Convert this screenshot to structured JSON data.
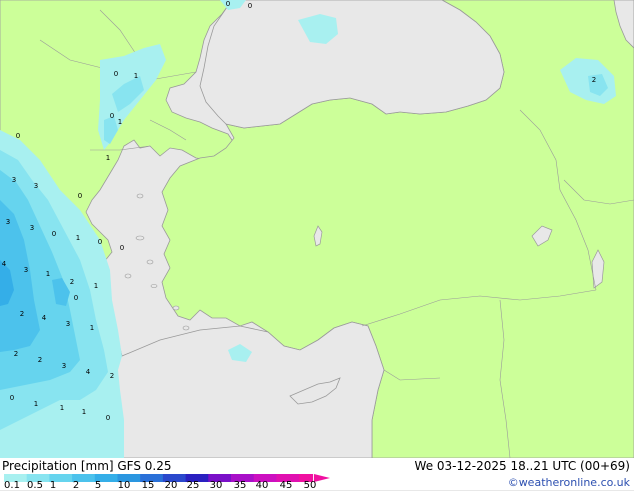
{
  "title": "Precipitation [mm]  GFS 0.25",
  "datetime": "We 03-12-2025 18..21 UTC (00+69)",
  "credit": "©weatheronline.co.uk",
  "colors": {
    "sea": "#e8e8e8",
    "land": "#ccff99",
    "coast": "#9a9a9a"
  },
  "legend": {
    "ticks": [
      "0.1",
      "0.5",
      "1",
      "2",
      "5",
      "10",
      "15",
      "20",
      "25",
      "30",
      "35",
      "40",
      "45",
      "50"
    ],
    "colors": [
      "#a8f0f0",
      "#88e4f0",
      "#66d4ee",
      "#4cc2ec",
      "#34aee8",
      "#2a96e0",
      "#2a70d8",
      "#2a48cc",
      "#2a20c0",
      "#7a10c8",
      "#a810c8",
      "#cc10c0",
      "#e010b0",
      "#f010a0"
    ]
  },
  "point_values": [
    {
      "v": "0"
    },
    {
      "v": "0"
    },
    {
      "v": "0"
    },
    {
      "v": "1"
    },
    {
      "v": "2"
    },
    {
      "v": "0"
    },
    {
      "v": "1"
    },
    {
      "v": "1"
    },
    {
      "v": "0"
    },
    {
      "v": "3"
    },
    {
      "v": "3"
    },
    {
      "v": "0"
    },
    {
      "v": "3"
    },
    {
      "v": "3"
    },
    {
      "v": "0"
    },
    {
      "v": "1"
    },
    {
      "v": "0"
    },
    {
      "v": "0"
    },
    {
      "v": "4"
    },
    {
      "v": "3"
    },
    {
      "v": "1"
    },
    {
      "v": "2"
    },
    {
      "v": "1"
    },
    {
      "v": "0"
    },
    {
      "v": "2"
    },
    {
      "v": "4"
    },
    {
      "v": "3"
    },
    {
      "v": "1"
    },
    {
      "v": "2"
    },
    {
      "v": "2"
    },
    {
      "v": "3"
    },
    {
      "v": "4"
    },
    {
      "v": "2"
    },
    {
      "v": "0"
    },
    {
      "v": "1"
    },
    {
      "v": "1"
    },
    {
      "v": "1"
    },
    {
      "v": "0"
    }
  ]
}
